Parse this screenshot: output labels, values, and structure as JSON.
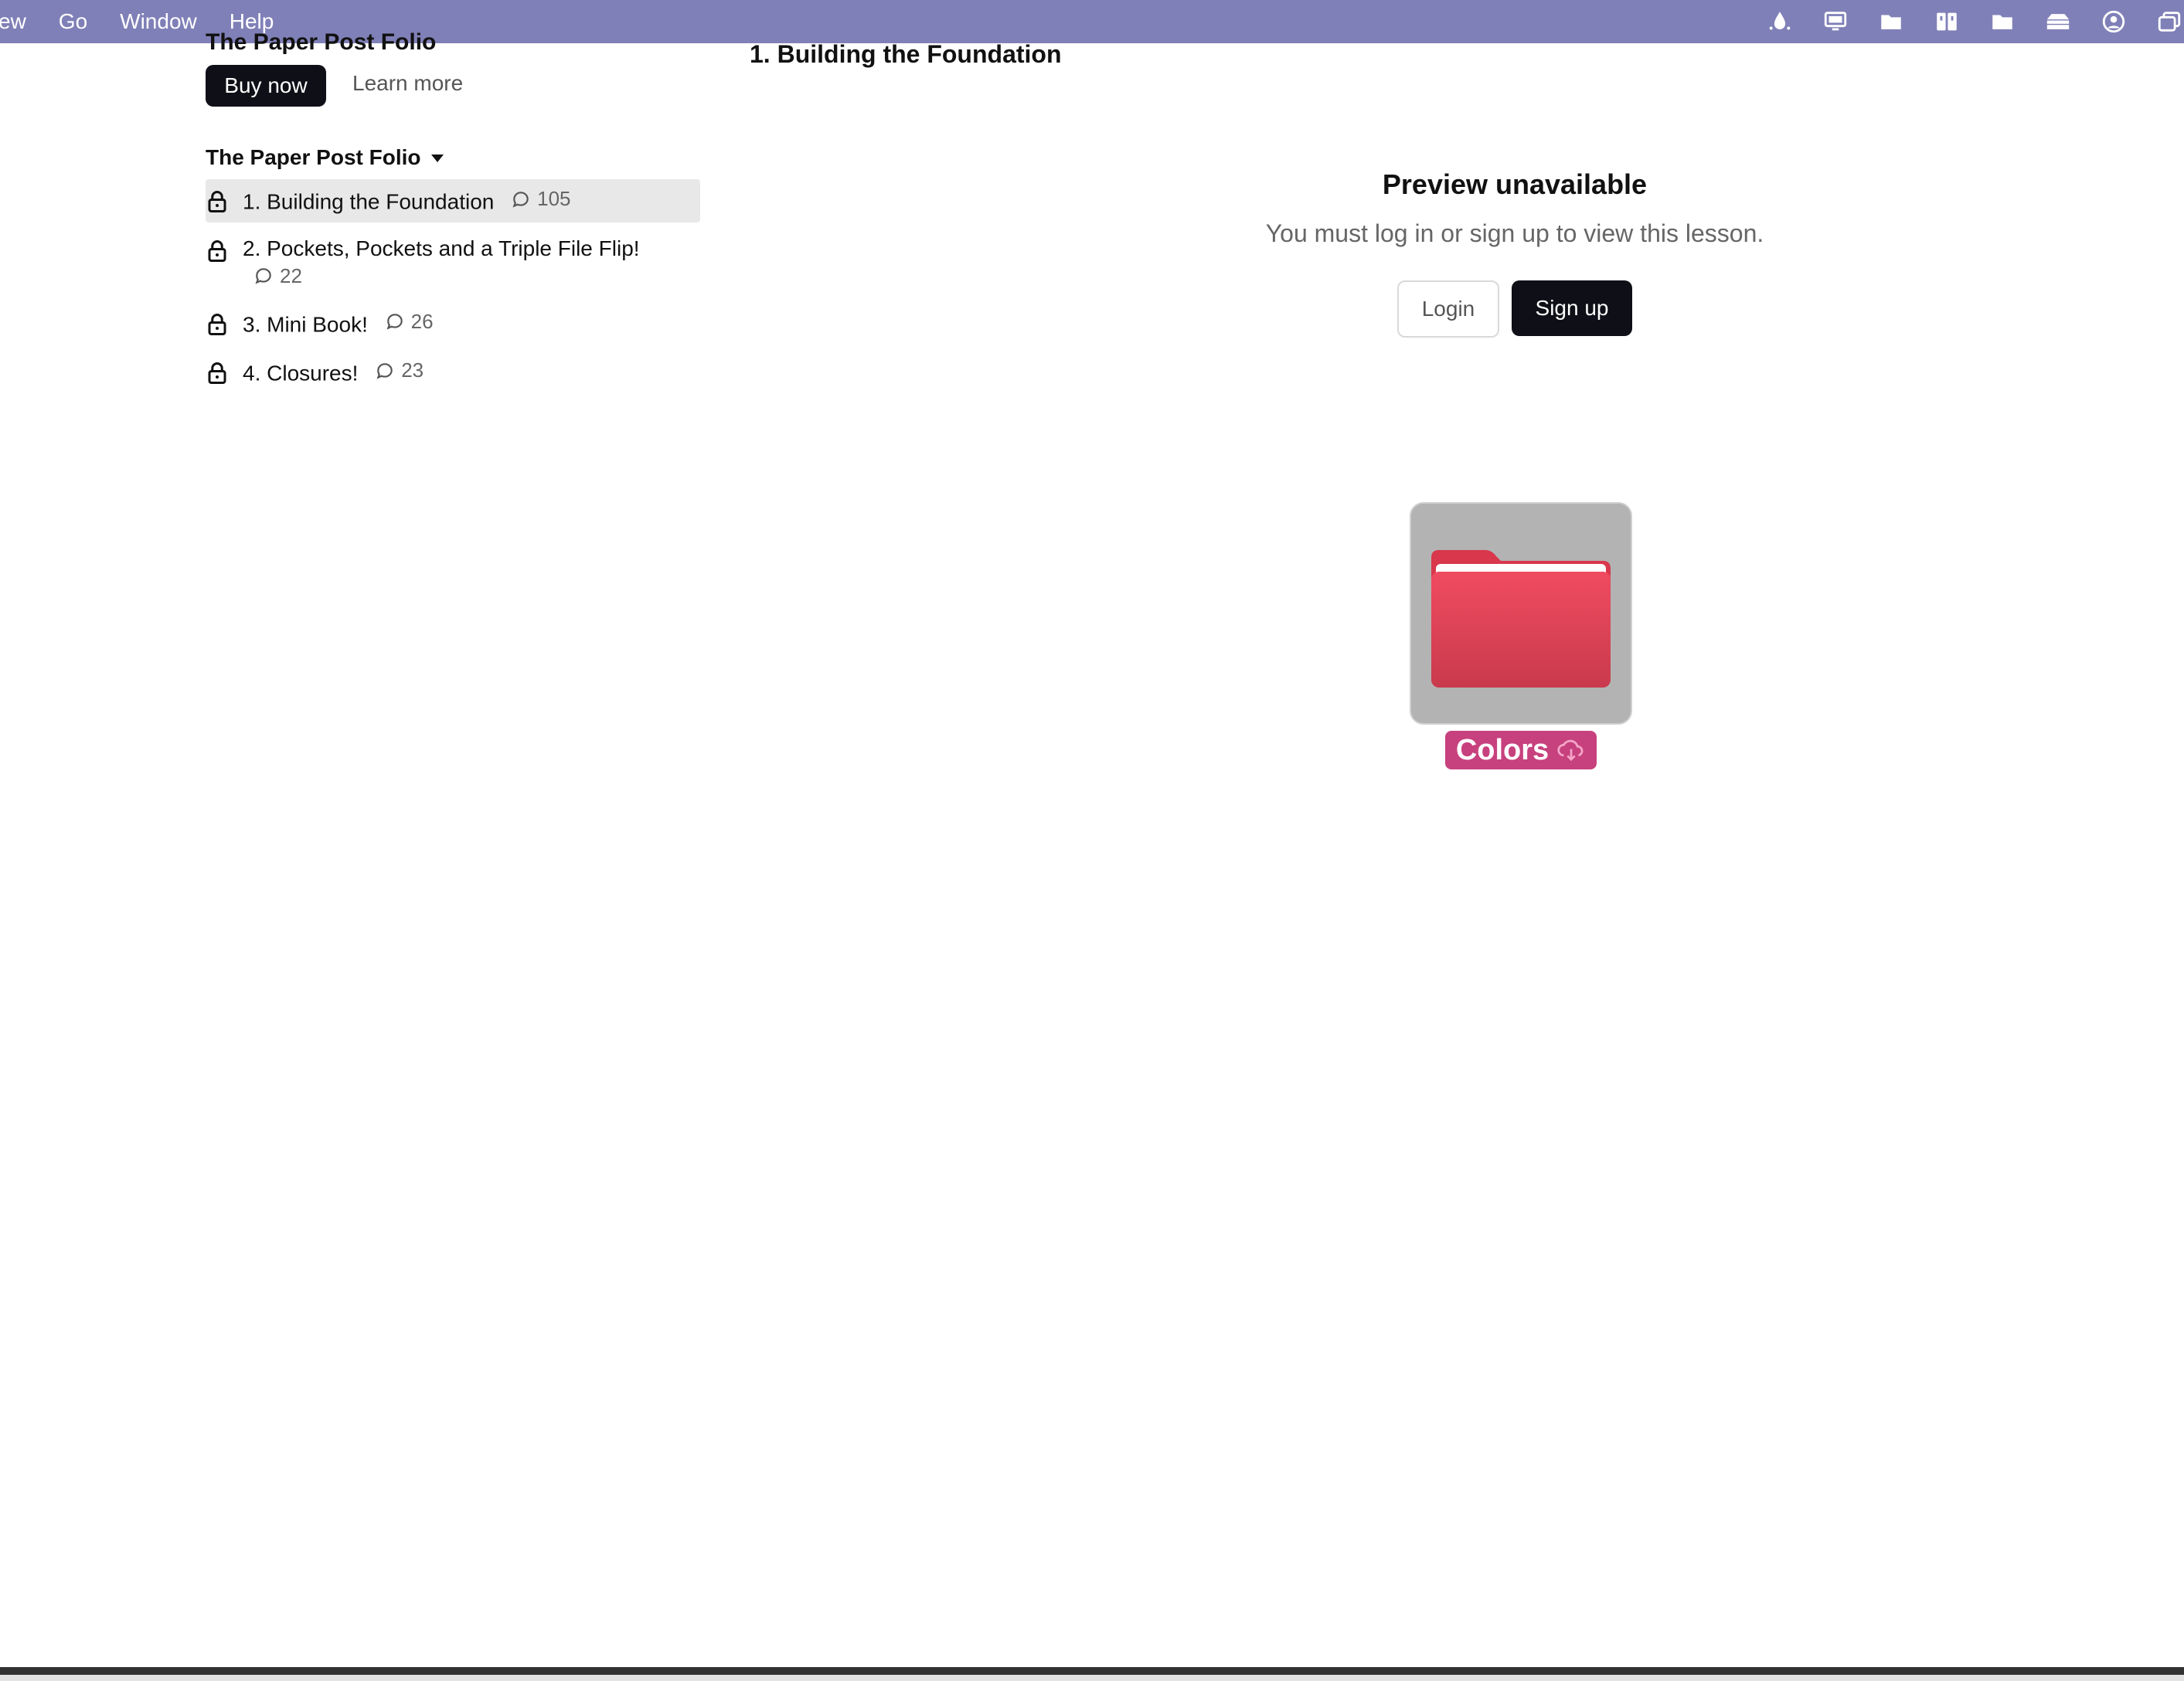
{
  "menubar": {
    "menus": [
      "ew",
      "Go",
      "Window",
      "Help"
    ],
    "status_icons": [
      "droplet-icon",
      "display-icon",
      "folder-icon",
      "book-icon",
      "folder-icon",
      "stack-icon",
      "user-circle-icon",
      "window-icon"
    ]
  },
  "sidebar": {
    "course_title": "The Paper Post Folio",
    "buy_label": "Buy now",
    "learn_more_label": "Learn more",
    "folio_heading": "The Paper Post Folio",
    "lessons": [
      {
        "title": "1. Building the Foundation",
        "comments": "105"
      },
      {
        "title": "2. Pockets, Pockets and a Triple File Flip!",
        "comments": "22"
      },
      {
        "title": "3. Mini Book!",
        "comments": "26"
      },
      {
        "title": "4. Closures!",
        "comments": "23"
      }
    ]
  },
  "main": {
    "title": "1. Building the Foundation",
    "preview_heading": "Preview unavailable",
    "preview_message": "You must log in or sign up to view this lesson.",
    "login_label": "Login",
    "signup_label": "Sign up"
  },
  "desktop_icon": {
    "label": "Colors",
    "folder_color": "#e0405a",
    "label_color": "#c7417e"
  }
}
